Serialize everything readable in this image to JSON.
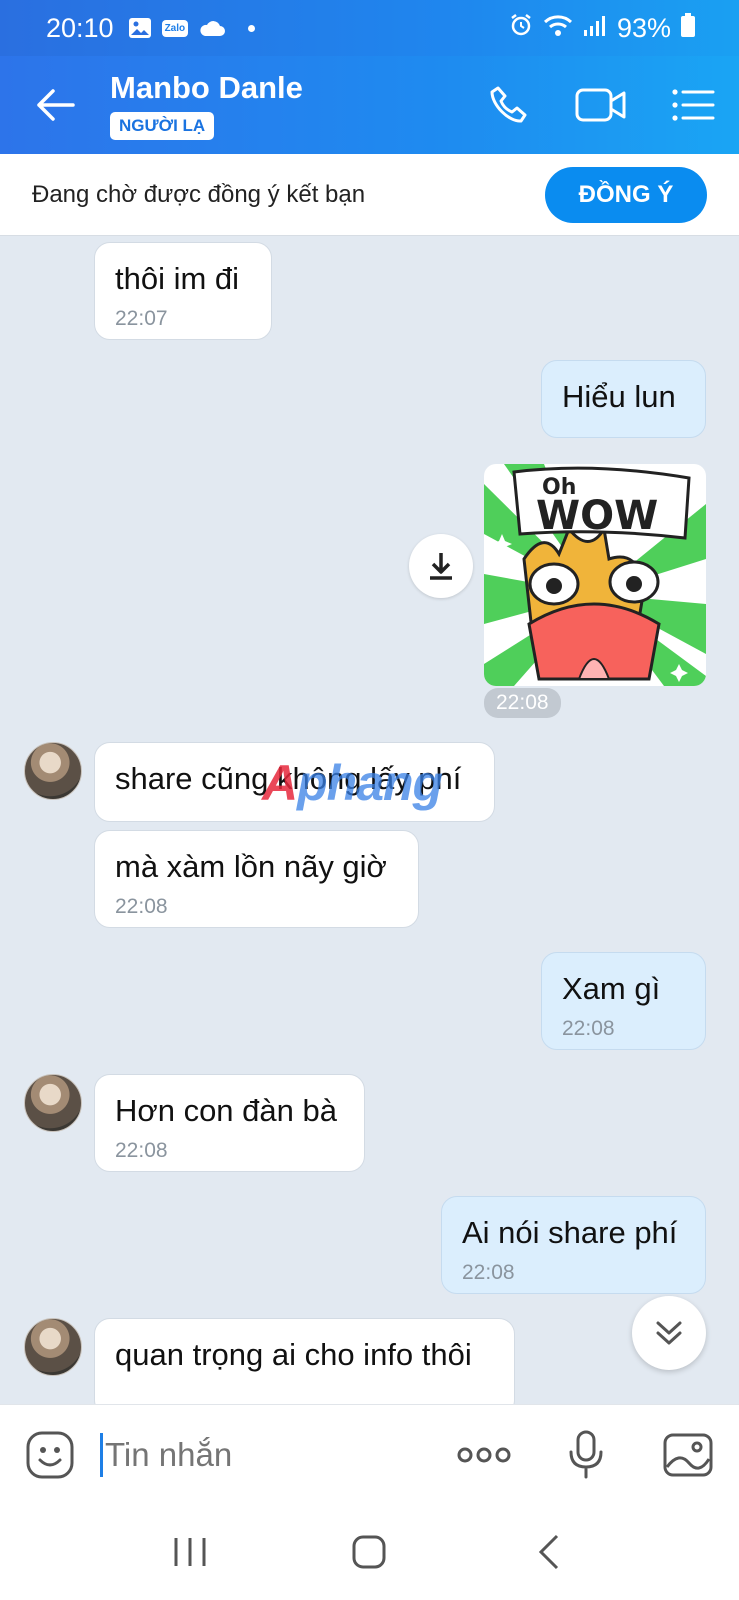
{
  "status_bar": {
    "time": "20:10",
    "zalo_label": "Zalo",
    "battery": "93%"
  },
  "header": {
    "contact_name": "Manbo Danle",
    "badge": "NGƯỜI LẠ"
  },
  "friend_request": {
    "text": "Đang chờ được đồng ý kết bạn",
    "accept_label": "ĐỒNG Ý"
  },
  "messages": [
    {
      "side": "in",
      "text": "thôi im đi",
      "time": "22:07"
    },
    {
      "side": "out",
      "text": "Hiểu lun"
    },
    {
      "side": "out",
      "type": "sticker",
      "sticker_text": "Oh WOW",
      "time": "22:08"
    },
    {
      "side": "in",
      "text": "share cũng không lấy phí"
    },
    {
      "side": "in",
      "text": "mà xàm lồn nãy giờ",
      "time": "22:08"
    },
    {
      "side": "out",
      "text": "Xam gì",
      "time": "22:08"
    },
    {
      "side": "in",
      "text": "Hơn con đàn bà",
      "time": "22:08"
    },
    {
      "side": "out",
      "text": "Ai nói share phí",
      "time": "22:08"
    },
    {
      "side": "in",
      "text": "quan trọng ai cho info thôi"
    }
  ],
  "watermark": {
    "part1": "A",
    "part2": "phang"
  },
  "composer": {
    "placeholder": "Tin nhắn"
  },
  "colors": {
    "header_start": "#2d74ea",
    "header_end": "#1aa5f4",
    "accent": "#0a8cf0",
    "outgoing_bubble": "#dbeefd",
    "chat_bg": "#e2e9f1"
  },
  "icons": [
    "back-arrow-icon",
    "phone-icon",
    "video-camera-icon",
    "menu-list-icon",
    "download-icon",
    "chevron-double-down-icon",
    "emoji-icon",
    "more-dots-icon",
    "microphone-icon",
    "image-icon",
    "recent-apps-icon",
    "home-icon",
    "nav-back-icon"
  ]
}
